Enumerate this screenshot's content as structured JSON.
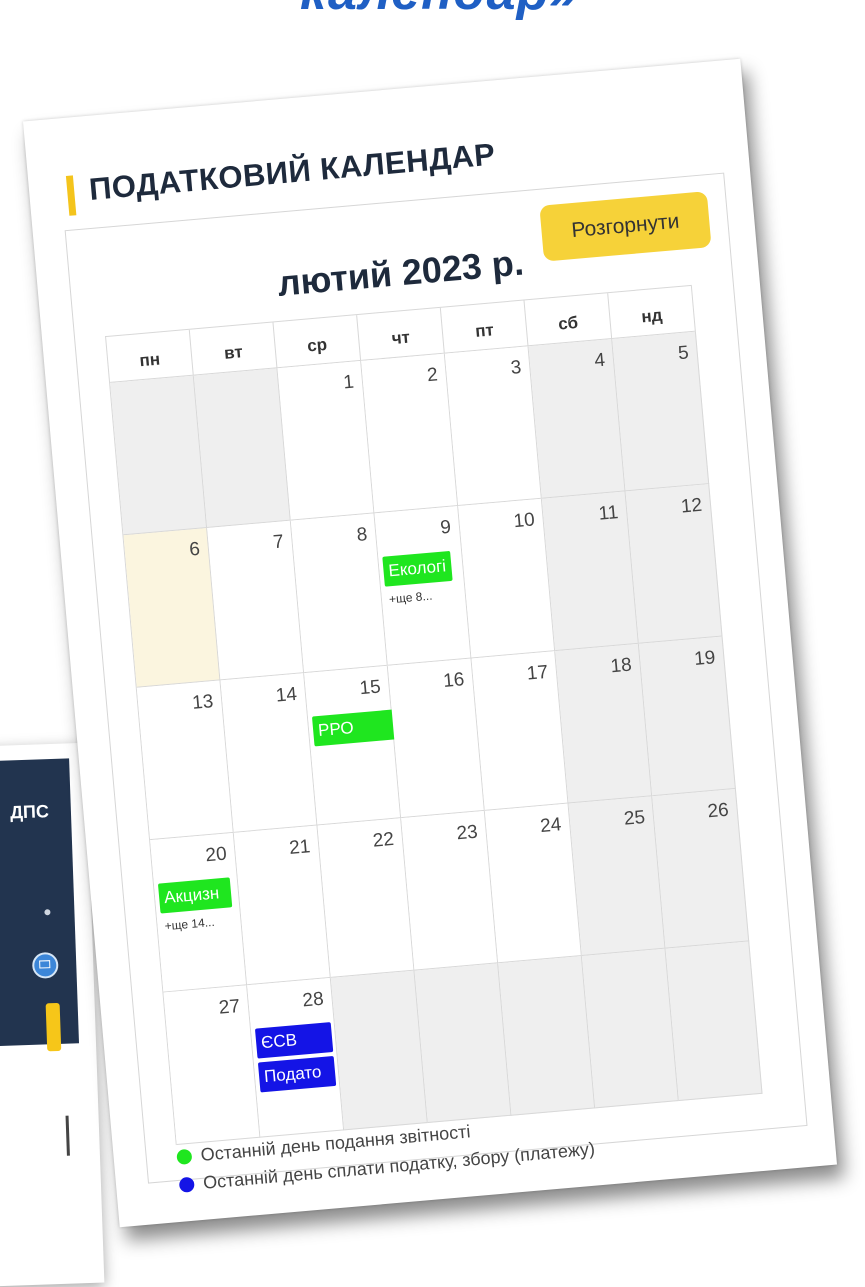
{
  "header": {
    "title": "календар»"
  },
  "back_card": {
    "label": "ДПС"
  },
  "calendar": {
    "heading": "ПОДАТКОВИЙ КАЛЕНДАР",
    "expand_label": "Розгорнути",
    "month_label": "лютий 2023 р.",
    "weekdays": [
      "пн",
      "вт",
      "ср",
      "чт",
      "пт",
      "сб",
      "нд"
    ],
    "days": {
      "d1": "1",
      "d2": "2",
      "d3": "3",
      "d4": "4",
      "d5": "5",
      "d6": "6",
      "d7": "7",
      "d8": "8",
      "d9": "9",
      "d10": "10",
      "d11": "11",
      "d12": "12",
      "d13": "13",
      "d14": "14",
      "d15": "15",
      "d16": "16",
      "d17": "17",
      "d18": "18",
      "d19": "19",
      "d20": "20",
      "d21": "21",
      "d22": "22",
      "d23": "23",
      "d24": "24",
      "d25": "25",
      "d26": "26",
      "d27": "27",
      "d28": "28"
    },
    "events": {
      "d9": "Екологі",
      "d9_more": "+ще 8...",
      "d15": "РРО",
      "d20": "Акцизн",
      "d20_more": "+ще 14...",
      "d28_a": "ЄСВ",
      "d28_b": "Подато"
    },
    "legend": {
      "report": "Останній день подання звітності",
      "payment": "Останній день сплати податку, збору (платежу)"
    },
    "colors": {
      "report": "#1fe61f",
      "payment": "#1414e6",
      "accent": "#f6d239"
    }
  }
}
